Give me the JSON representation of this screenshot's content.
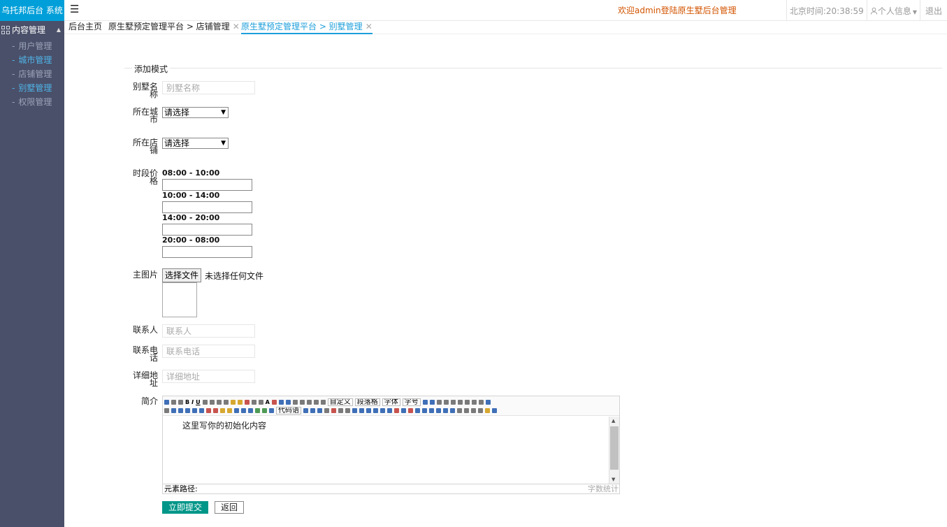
{
  "header": {
    "logo": "乌托邦后台 系统",
    "menu_icon": "☰",
    "welcome": "欢迎admin登陆原生墅后台管理",
    "time_label": "北京时间:",
    "time_value": "20:38:59",
    "user_info": "个人信息",
    "logout": "退出"
  },
  "sidebar": {
    "group": "内容管理",
    "items": [
      {
        "label": "用户管理"
      },
      {
        "label": "城市管理"
      },
      {
        "label": "店铺管理"
      },
      {
        "label": "别墅管理"
      },
      {
        "label": "权限管理"
      }
    ]
  },
  "tabs": [
    {
      "label": "后台主页"
    },
    {
      "label": "原生墅预定管理平台 > 店铺管理"
    },
    {
      "label": "原生墅预定管理平台 > 别墅管理"
    }
  ],
  "form": {
    "legend": "添加模式",
    "villa_name": {
      "label": "别墅名称",
      "placeholder": "别墅名称"
    },
    "city": {
      "label": "所在城市",
      "value": "请选择"
    },
    "shop": {
      "label": "所在店铺",
      "value": "请选择"
    },
    "price": {
      "label": "时段价格",
      "slots": [
        "08:00 - 10:00",
        "10:00 - 14:00",
        "14:00 - 20:00",
        "20:00 - 08:00"
      ]
    },
    "image": {
      "label": "主图片",
      "button": "选择文件",
      "status": "未选择任何文件"
    },
    "contact": {
      "label": "联系人",
      "placeholder": "联系人"
    },
    "phone": {
      "label": "联系电话",
      "placeholder": "联系电话"
    },
    "address": {
      "label": "详细地址",
      "placeholder": "详细地址"
    },
    "intro": {
      "label": "简介",
      "content": "这里写你的初始化内容",
      "toolbar_combos": [
        "自定义",
        "段落格",
        "字体",
        "字号",
        "代码语"
      ],
      "path_label": "元素路径:",
      "count_label": "字数统计"
    },
    "submit": "立即提交",
    "back": "返回"
  },
  "colors": {
    "logo_bg": "#009fd9",
    "sidebar_bg": "#4a5069",
    "welcome": "#d35400",
    "active_tab": "#1e9fdb",
    "submit_bg": "#009688"
  }
}
